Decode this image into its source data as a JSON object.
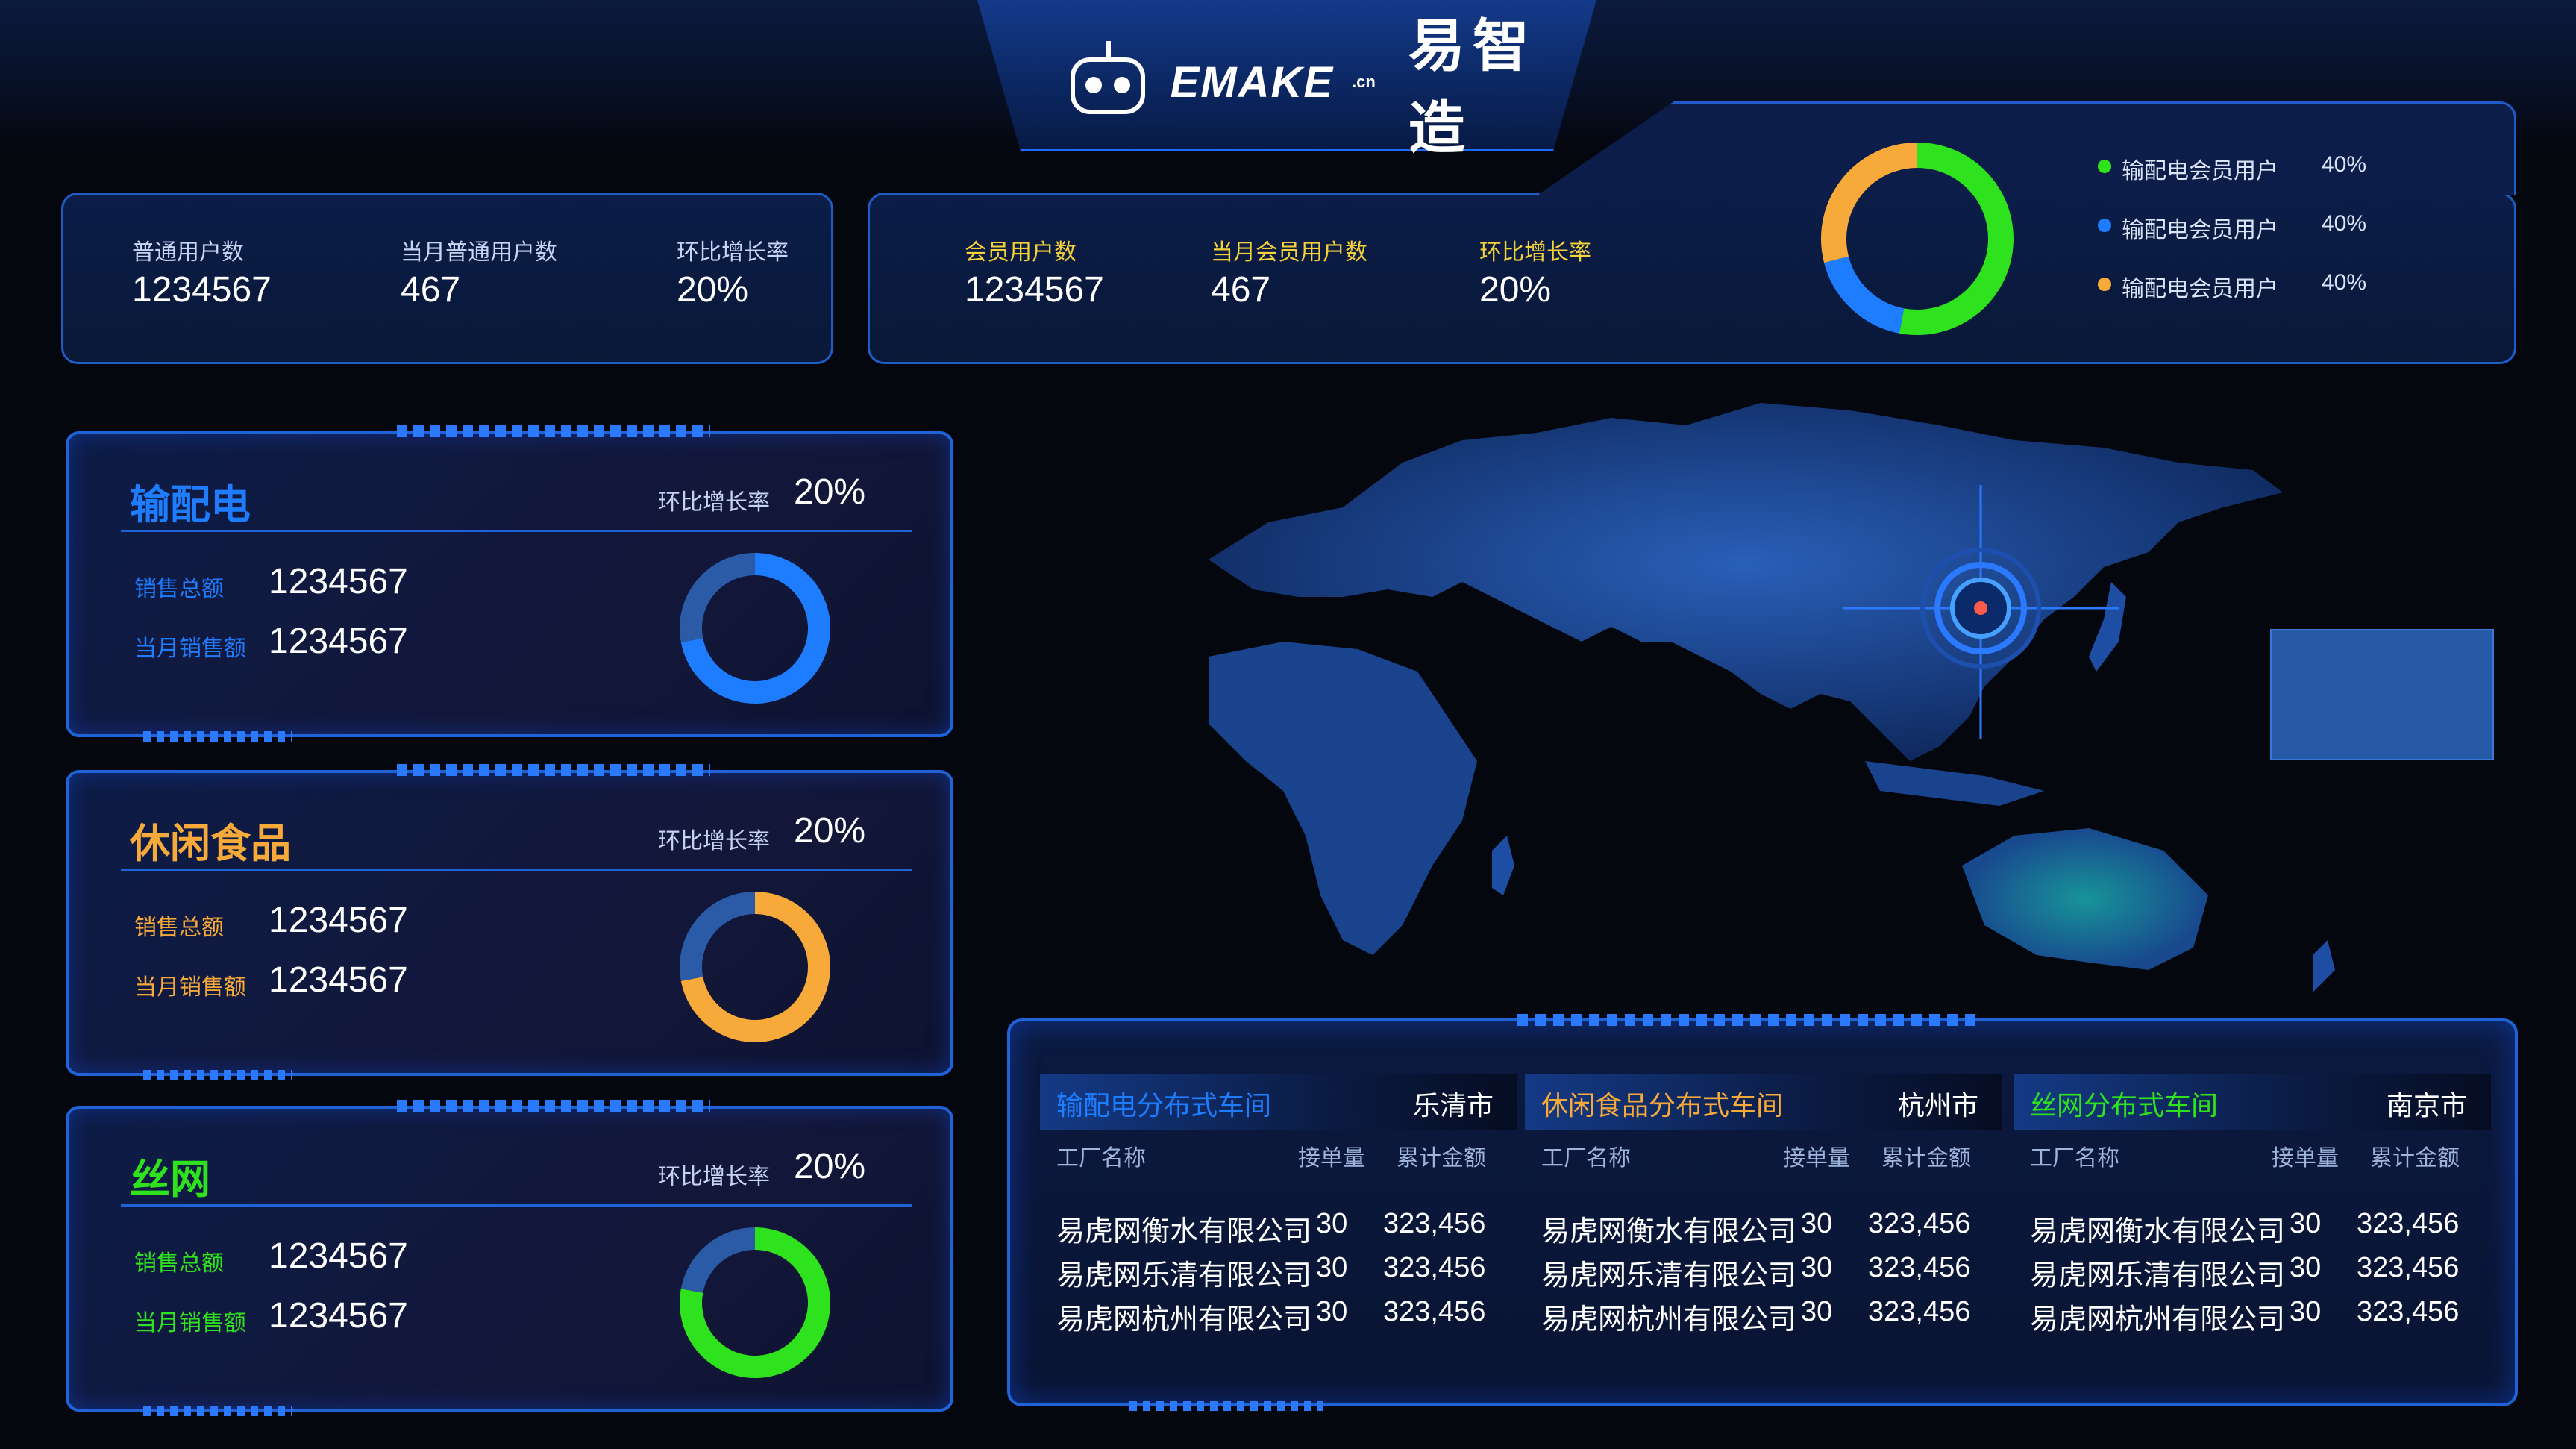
{
  "header": {
    "logo_text": "EMAKE",
    "logo_suffix": ".cn",
    "brand_cn": "易智造"
  },
  "stats_regular": {
    "items": [
      {
        "label": "普通用户数",
        "value": "1234567"
      },
      {
        "label": "当月普通用户数",
        "value": "467"
      },
      {
        "label": "环比增长率",
        "value": "20%"
      }
    ]
  },
  "stats_member": {
    "items": [
      {
        "label": "会员用户数",
        "value": "1234567"
      },
      {
        "label": "当月会员用户数",
        "value": "467"
      },
      {
        "label": "环比增长率",
        "value": "20%"
      }
    ]
  },
  "member_donut": {
    "legend": [
      {
        "label": "输配电会员用户",
        "value": "40%",
        "color": "#2ee31e"
      },
      {
        "label": "输配电会员用户",
        "value": "40%",
        "color": "#1e7dff"
      },
      {
        "label": "输配电会员用户",
        "value": "40%",
        "color": "#f7a93a"
      }
    ],
    "segments": [
      {
        "fraction": 0.53,
        "color": "#2ee31e"
      },
      {
        "fraction": 0.18,
        "color": "#1e7dff"
      },
      {
        "fraction": 0.29,
        "color": "#f7a93a"
      }
    ]
  },
  "cards": [
    {
      "title": "输配电",
      "accent": "#1e7dff",
      "rate_label": "环比增长率",
      "rate": "20%",
      "total_label": "销售总额",
      "total": "1234567",
      "month_label": "当月销售额",
      "month": "1234567",
      "fraction": 0.72,
      "rest_color": "#2b5aa6"
    },
    {
      "title": "休闲食品",
      "accent": "#f7a93a",
      "rate_label": "环比增长率",
      "rate": "20%",
      "total_label": "销售总额",
      "total": "1234567",
      "month_label": "当月销售额",
      "month": "1234567",
      "fraction": 0.72,
      "rest_color": "#2b5aa6"
    },
    {
      "title": "丝网",
      "accent": "#2ee31e",
      "rate_label": "环比增长率",
      "rate": "20%",
      "total_label": "销售总额",
      "total": "1234567",
      "month_label": "当月销售额",
      "month": "1234567",
      "fraction": 0.78,
      "rest_color": "#2b5aa6"
    }
  ],
  "tables": [
    {
      "title": "输配电分布式车间",
      "title_color": "#1e7dff",
      "city": "乐清市",
      "columns": [
        "工厂名称",
        "接单量",
        "累计金额"
      ],
      "rows": [
        [
          "易虎网衡水有限公司",
          "30",
          "323,456"
        ],
        [
          "易虎网乐清有限公司",
          "30",
          "323,456"
        ],
        [
          "易虎网杭州有限公司",
          "30",
          "323,456"
        ]
      ]
    },
    {
      "title": "休闲食品分布式车间",
      "title_color": "#f7a93a",
      "city": "杭州市",
      "columns": [
        "工厂名称",
        "接单量",
        "累计金额"
      ],
      "rows": [
        [
          "易虎网衡水有限公司",
          "30",
          "323,456"
        ],
        [
          "易虎网乐清有限公司",
          "30",
          "323,456"
        ],
        [
          "易虎网杭州有限公司",
          "30",
          "323,456"
        ]
      ]
    },
    {
      "title": "丝网分布式车间",
      "title_color": "#2ee31e",
      "city": "南京市",
      "columns": [
        "工厂名称",
        "接单量",
        "累计金额"
      ],
      "rows": [
        [
          "易虎网衡水有限公司",
          "30",
          "323,456"
        ],
        [
          "易虎网乐清有限公司",
          "30",
          "323,456"
        ],
        [
          "易虎网杭州有限公司",
          "30",
          "323,456"
        ]
      ]
    }
  ]
}
